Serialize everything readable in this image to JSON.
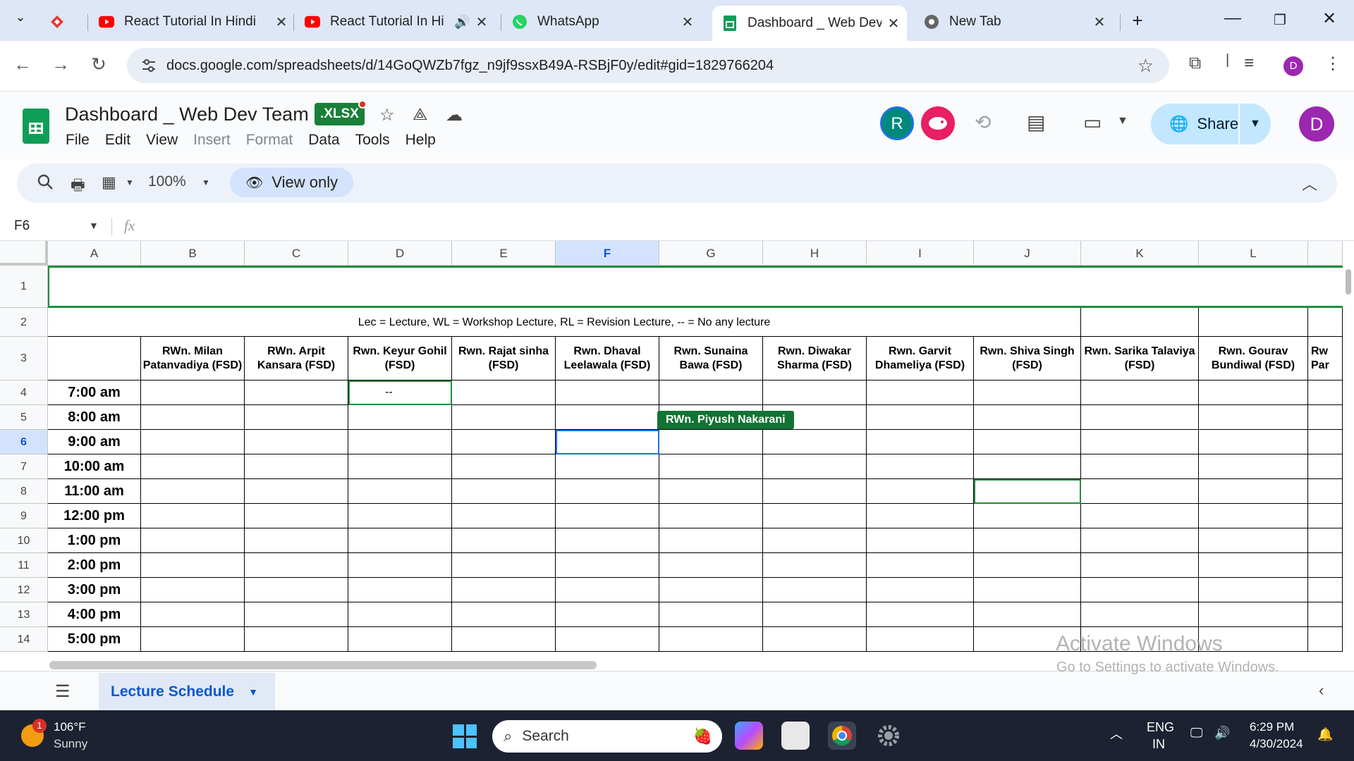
{
  "browser": {
    "tabs": [
      {
        "title": "",
        "icon": "gitbook-icon"
      },
      {
        "title": "React Tutorial In Hindi",
        "icon": "youtube-icon"
      },
      {
        "title": "React Tutorial In Hi",
        "icon": "youtube-icon",
        "audio": true
      },
      {
        "title": "WhatsApp",
        "icon": "whatsapp-icon"
      },
      {
        "title": "Dashboard _ Web Dev T",
        "icon": "sheets-icon",
        "active": true
      },
      {
        "title": "New Tab",
        "icon": "chrome-icon"
      }
    ],
    "new_tab_label": "+",
    "url": "docs.google.com/spreadsheets/d/14GoQWZb7fgz_n9jf9ssxB49A-RSBjF0y/edit#gid=1829766204",
    "profile_initial": "D"
  },
  "sheets": {
    "doc_title": "Dashboard _ Web Dev Team",
    "file_badge": ".XLSX",
    "menu": [
      "File",
      "Edit",
      "View",
      "Insert",
      "Format",
      "Data",
      "Tools",
      "Help"
    ],
    "menu_disabled": [
      "Insert",
      "Format"
    ],
    "collaborators": [
      {
        "initial": "R",
        "color": "#00897b"
      },
      {
        "initial": "",
        "color": "#e91e63"
      }
    ],
    "share_label": "Share",
    "user_initial": "D",
    "zoom": "100%",
    "view_only_label": "View only",
    "name_box": "F6",
    "fx_label": "fx"
  },
  "grid": {
    "columns": [
      "A",
      "B",
      "C",
      "D",
      "E",
      "F",
      "G",
      "H",
      "I",
      "J",
      "K",
      "L"
    ],
    "selected_column": "F",
    "rows": [
      "1",
      "2",
      "3",
      "4",
      "5",
      "6",
      "7",
      "8",
      "9",
      "10",
      "11",
      "12",
      "13",
      "14"
    ],
    "selected_row": "6",
    "legend": "Lec = Lecture, WL = Workshop Lecture, RL = Revision Lecture, -- = No any lecture",
    "headers": [
      "RWn. Milan Patanvadiya (FSD)",
      "RWn. Arpit Kansara  (FSD)",
      "Rwn. Keyur Gohil (FSD)",
      "Rwn. Rajat sinha (FSD)",
      "Rwn. Dhaval Leelawala (FSD)",
      "Rwn. Sunaina Bawa (FSD)",
      "Rwn. Diwakar Sharma (FSD)",
      "Rwn. Garvit Dhameliya (FSD)",
      "Rwn. Shiva Singh (FSD)",
      "Rwn. Sarika Talaviya (FSD)",
      "Rwn. Gourav Bundiwal (FSD)",
      "Rw Par"
    ],
    "times": [
      "7:00 am",
      "8:00 am",
      "9:00 am",
      "10:00 am",
      "11:00 am",
      "12:00 pm",
      "1:00 pm",
      "2:00 pm",
      "3:00 pm",
      "4:00 pm",
      "5:00 pm"
    ],
    "d4_value": "--",
    "collab_tag": "RWn. Piyush Nakarani"
  },
  "sheet_tabs": {
    "active": "Lecture Schedule"
  },
  "watermark": {
    "line1": "Activate Windows",
    "line2": "Go to Settings to activate Windows."
  },
  "taskbar": {
    "weather_badge": "1",
    "temp": "106°F",
    "condition": "Sunny",
    "search_placeholder": "Search",
    "lang1": "ENG",
    "lang2": "IN",
    "time": "6:29 PM",
    "date": "4/30/2024"
  }
}
